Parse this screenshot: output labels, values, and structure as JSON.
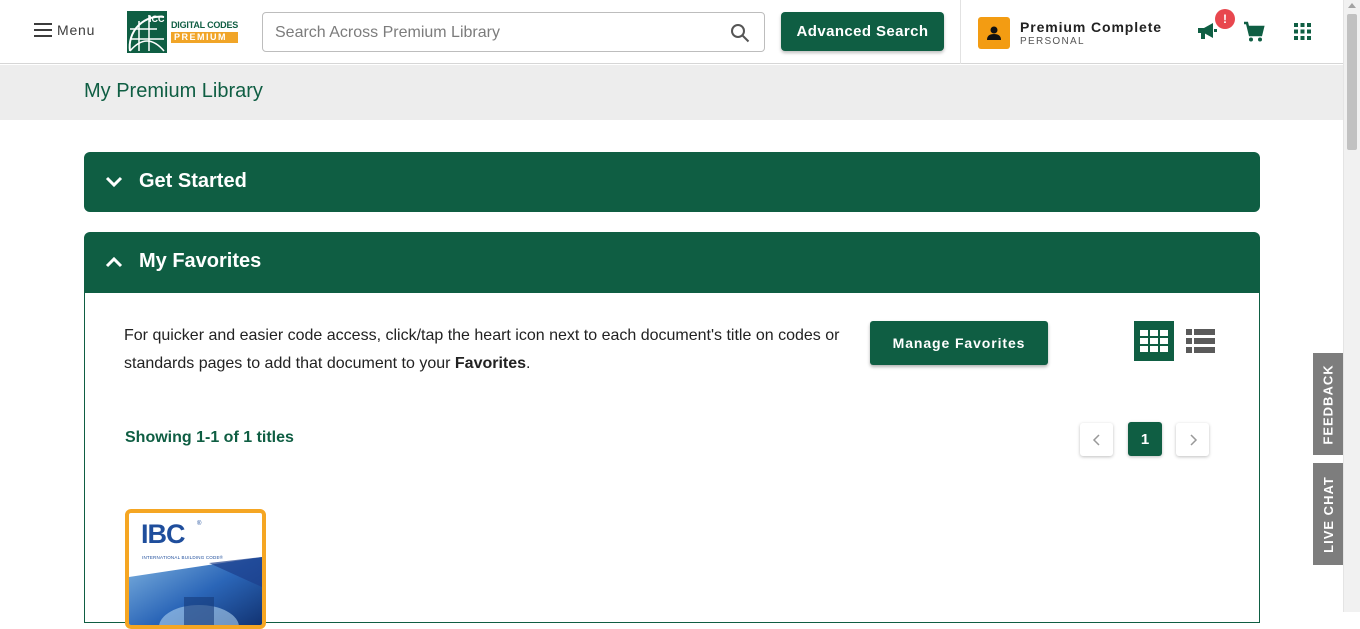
{
  "header": {
    "menu_label": "Menu",
    "logo": {
      "badge": "ICC",
      "line1": "DIGITAL CODES",
      "line2": "PREMIUM"
    },
    "search": {
      "placeholder": "Search Across Premium Library",
      "value": ""
    },
    "advanced_search_label": "Advanced Search",
    "user": {
      "plan": "Premium Complete",
      "type": "PERSONAL"
    },
    "notification_badge": "!",
    "icons": [
      "hamburger-icon",
      "search-icon",
      "user-icon",
      "megaphone-icon",
      "cart-icon",
      "apps-grid-icon"
    ]
  },
  "breadcrumb": {
    "title": "My Premium Library"
  },
  "panels": {
    "get_started": {
      "title": "Get Started",
      "expanded": false
    },
    "favorites": {
      "title": "My Favorites",
      "expanded": true,
      "description_part1": "For quicker and easier code access, click/tap the heart icon next to each document's title on codes or standards pages to add that document to your ",
      "description_bold": "Favorites",
      "description_end": ".",
      "manage_label": "Manage Favorites",
      "view_mode": "grid",
      "showing": "Showing 1-1 of 1 titles",
      "pagination": {
        "current": "1"
      },
      "books": [
        {
          "code": "IBC",
          "mark": "®",
          "subtitle": "INTERNATIONAL BUILDING CODE®"
        }
      ]
    }
  },
  "side_tabs": {
    "feedback": "FEEDBACK",
    "live_chat": "LIVE CHAT"
  },
  "colors": {
    "brand_green": "#0f5e43",
    "accent_orange": "#f39c12",
    "badge_red": "#e8474e",
    "side_tab_gray": "#7d7d7d"
  }
}
